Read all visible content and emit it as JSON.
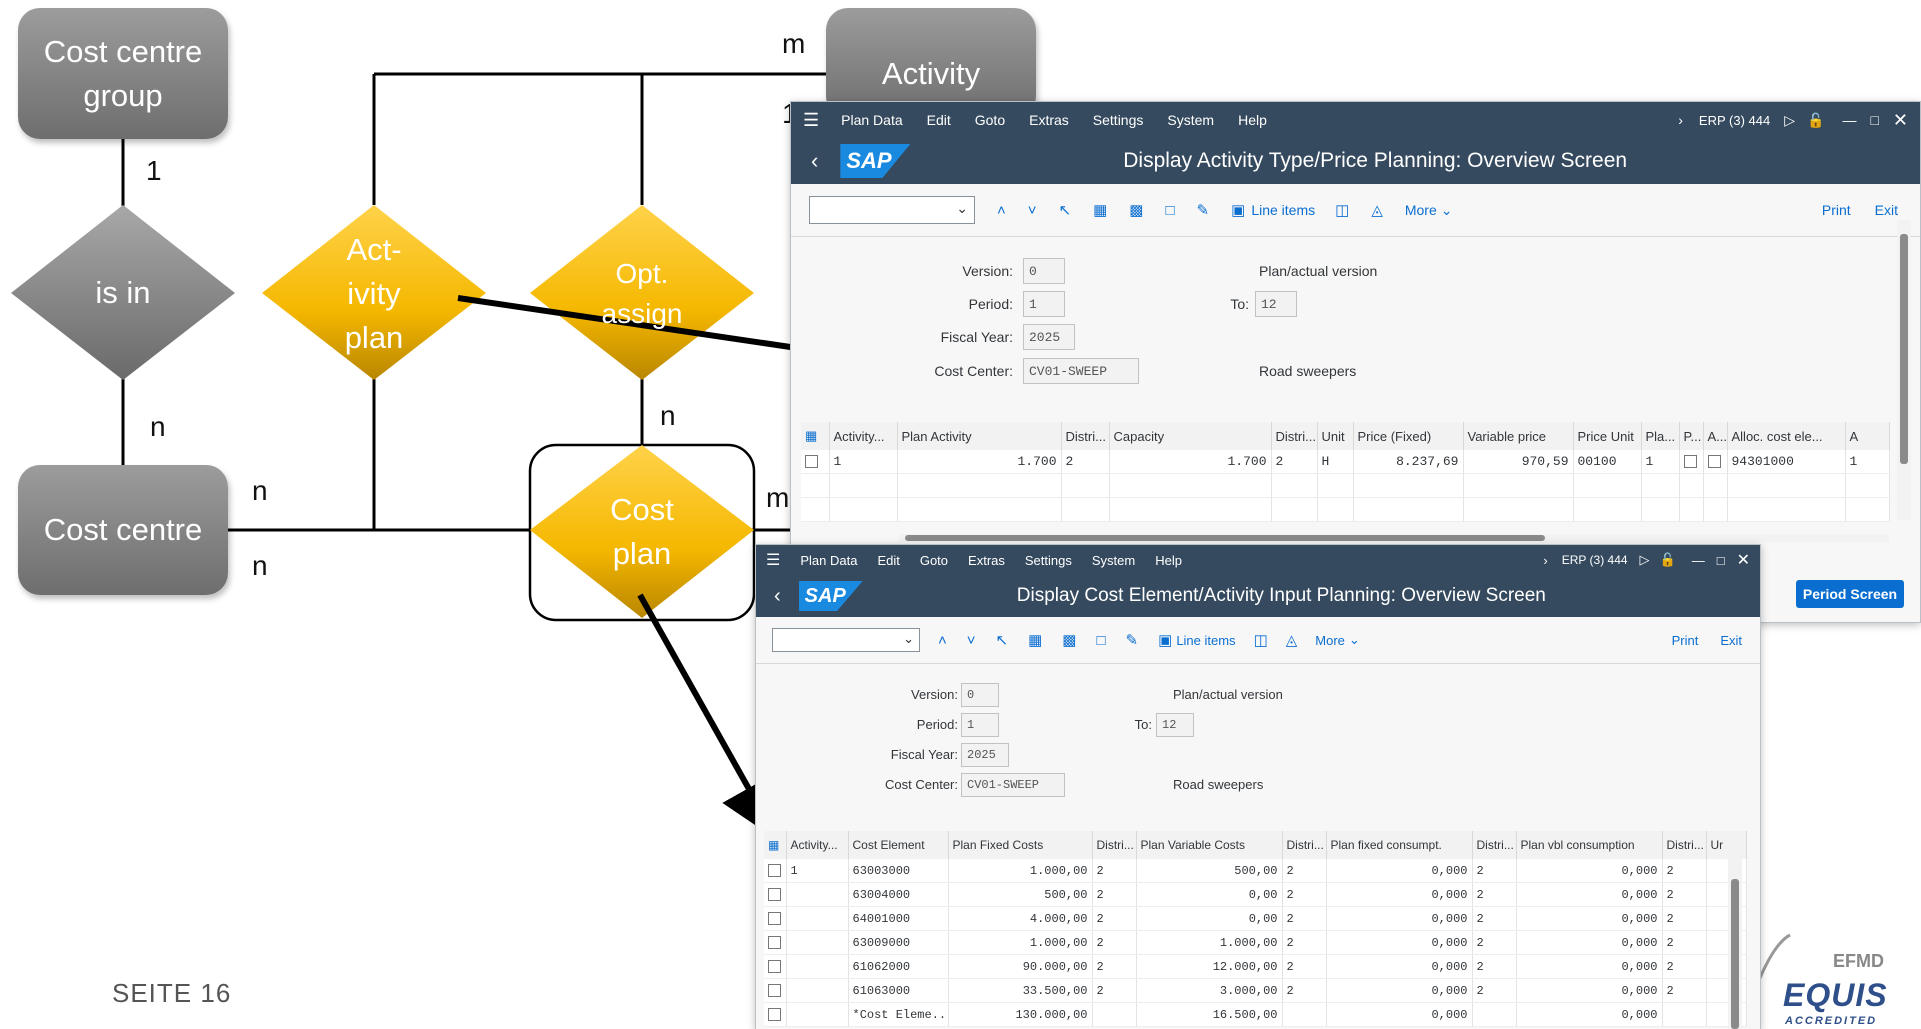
{
  "diagram": {
    "entities": {
      "cost_centre_group": "Cost centre group",
      "activity": "Activity",
      "cost_centre": "Cost centre"
    },
    "relations": {
      "is_in": "is in",
      "activity_plan": [
        "Act-",
        "ivity",
        "plan"
      ],
      "opt_assign": [
        "Opt.",
        "assign"
      ],
      "cost_plan": [
        "Cost",
        "plan"
      ]
    },
    "cardinalities": {
      "group_is_in": "1",
      "is_in_centre": "n",
      "activity_top": "m",
      "activity_right": "1",
      "opt_cost_plan": "n",
      "centre_right_upper": "n",
      "centre_right_lower": "n",
      "cost_plan_right": "m"
    },
    "footer": "SEITE 16",
    "logo": {
      "efmd": "EFMD",
      "equis": "EQUIS",
      "accredited": "ACCREDITED"
    }
  },
  "window1": {
    "menu": [
      "Plan Data",
      "Edit",
      "Goto",
      "Extras",
      "Settings",
      "System",
      "Help"
    ],
    "system": "ERP (3) 444",
    "title": "Display Activity Type/Price Planning: Overview Screen",
    "toolbar": {
      "line_items": "Line items",
      "more": "More",
      "print": "Print",
      "exit": "Exit"
    },
    "fields": {
      "version_label": "Version:",
      "version": "0",
      "period_label": "Period:",
      "period": "1",
      "to_label": "To:",
      "to": "12",
      "fiscal_label": "Fiscal Year:",
      "fiscal": "2025",
      "cc_label": "Cost Center:",
      "cc": "CV01-SWEEP",
      "plan_actual": "Plan/actual version",
      "cc_desc": "Road sweepers"
    },
    "columns": [
      "Activity...",
      "Plan Activity",
      "Distri...",
      "Capacity",
      "Distri...",
      "Unit",
      "Price (Fixed)",
      "Variable price",
      "Price Unit",
      "Pla...",
      "P...",
      "A...",
      "Alloc. cost ele...",
      "A"
    ],
    "row": {
      "activity": "1",
      "plan_activity": "1.700",
      "distri1": "2",
      "capacity": "1.700",
      "distri2": "2",
      "unit": "H",
      "price_fixed": "8.237,69",
      "variable_price": "970,59",
      "price_unit": "00100",
      "pla": "1",
      "alloc": "94301000",
      "a": "1"
    },
    "period_button": "Period Screen"
  },
  "window2": {
    "menu": [
      "Plan Data",
      "Edit",
      "Goto",
      "Extras",
      "Settings",
      "System",
      "Help"
    ],
    "system": "ERP (3) 444",
    "title": "Display Cost Element/Activity Input Planning: Overview Screen",
    "toolbar": {
      "line_items": "Line items",
      "more": "More",
      "print": "Print",
      "exit": "Exit"
    },
    "fields": {
      "version_label": "Version:",
      "version": "0",
      "period_label": "Period:",
      "period": "1",
      "to_label": "To:",
      "to": "12",
      "fiscal_label": "Fiscal Year:",
      "fiscal": "2025",
      "cc_label": "Cost Center:",
      "cc": "CV01-SWEEP",
      "plan_actual": "Plan/actual version",
      "cc_desc": "Road sweepers"
    },
    "columns": [
      "Activity...",
      "Cost Element",
      "Plan Fixed Costs",
      "Distri...",
      "Plan Variable Costs",
      "Distri...",
      "Plan fixed consumpt.",
      "Distri...",
      "Plan vbl consumption",
      "Distri...",
      "Ur"
    ],
    "rows": [
      [
        "1",
        "63003000",
        "1.000,00",
        "2",
        "500,00",
        "2",
        "0,000",
        "2",
        "0,000",
        "2"
      ],
      [
        "",
        "63004000",
        "500,00",
        "2",
        "0,00",
        "2",
        "0,000",
        "2",
        "0,000",
        "2"
      ],
      [
        "",
        "64001000",
        "4.000,00",
        "2",
        "0,00",
        "2",
        "0,000",
        "2",
        "0,000",
        "2"
      ],
      [
        "",
        "63009000",
        "1.000,00",
        "2",
        "1.000,00",
        "2",
        "0,000",
        "2",
        "0,000",
        "2"
      ],
      [
        "",
        "61062000",
        "90.000,00",
        "2",
        "12.000,00",
        "2",
        "0,000",
        "2",
        "0,000",
        "2"
      ],
      [
        "",
        "61063000",
        "33.500,00",
        "2",
        "3.000,00",
        "2",
        "0,000",
        "2",
        "0,000",
        "2"
      ],
      [
        "",
        "*Cost Eleme...",
        "130.000,00",
        "",
        "16.500,00",
        "",
        "0,000",
        "",
        "0,000",
        ""
      ]
    ]
  }
}
